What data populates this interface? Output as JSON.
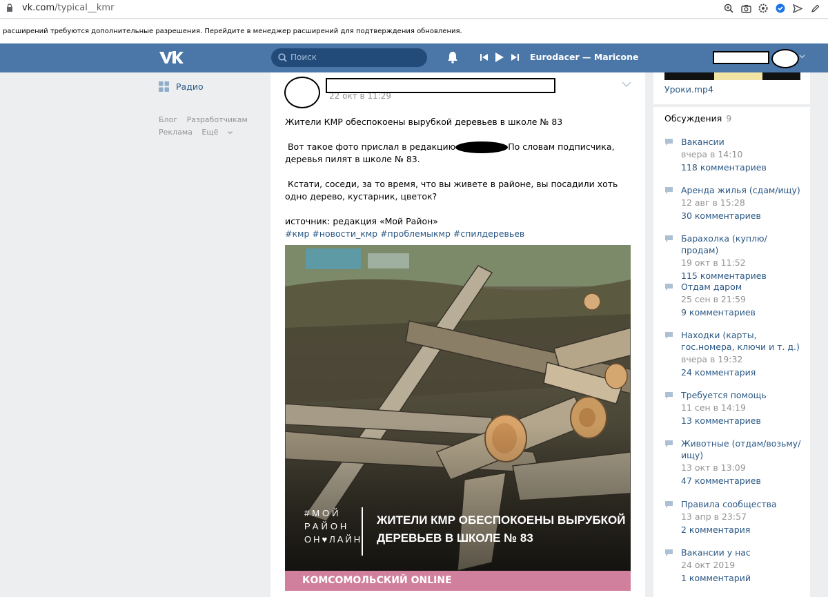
{
  "browser": {
    "url_host": "vk.com",
    "url_path": "/typical__kmr",
    "icons": [
      "zoom-icon",
      "camera-icon",
      "settings-icon",
      "shield-extension-icon",
      "send-icon",
      "pencil-icon"
    ]
  },
  "notice": {
    "text": "расширений требуются дополнительные разрешения. Перейдите в менеджер расширений для подтверждения обновления."
  },
  "header": {
    "search_placeholder": "Поиск",
    "track": "Eurodacer — Maricone",
    "accent": "#4a76a8"
  },
  "leftnav": {
    "items": [
      {
        "label": "Радио",
        "icon": "grid-icon"
      }
    ],
    "footer": [
      "Блог",
      "Разработчикам",
      "Реклама",
      "Ещё"
    ]
  },
  "post": {
    "date": "22 окт в 11:29",
    "title": "Жители КМР обеспокоены вырубкой деревьев в школе № 83",
    "para1_a": "Вот такое фото прислал в редакцию",
    "para1_b": "По словам подписчика, деревья пилят в школе № 83.",
    "para2": "Кстати, соседи, за то время, что вы живете в районе, вы посадили хоть одно дерево, кустарник, цветок?",
    "source": "источник: редакция «Мой Район»",
    "hashtags": "#кмр #новости_кмр #проблемыкмр #спилдеревьев",
    "image": {
      "logo": [
        "#МОЙ",
        "РАЙОН",
        "ОН♥ЛАЙН"
      ],
      "headline_1": "ЖИТЕЛИ КМР ОБЕСПОКОЕНЫ ВЫРУБКОЙ",
      "headline_2": "ДЕРЕВЬЕВ В ШКОЛЕ № 83",
      "band": "КОМСОМОЛЬСКИЙ ONLINE"
    }
  },
  "right": {
    "video_title": "Уроки.mp4",
    "discussions_label": "Обсуждения",
    "discussions_count": "9",
    "topics": [
      {
        "title": "Вакансии",
        "time": "вчера в 14:10",
        "count": "118 комментариев"
      },
      {
        "title": "Аренда жилья (сдам/ищу)",
        "time": "12 авг в 15:28",
        "count": "30 комментариев"
      },
      {
        "title": "Барахолка (куплю/продам)",
        "time": "19 окт в 11:52",
        "count": "115 комментариев"
      },
      {
        "title": "Отдам даром",
        "time": "25 сен в 21:59",
        "count": "9 комментариев"
      },
      {
        "title": "Находки (карты, гос.номера, ключи и т. д.)",
        "time": "вчера в 19:32",
        "count": "24 комментария"
      },
      {
        "title": "Требуется помощь",
        "time": "11 сен в 14:19",
        "count": "13 комментариев"
      },
      {
        "title": "Животные (отдам/возьму/ищу)",
        "time": "13 окт в 13:09",
        "count": "47 комментариев"
      },
      {
        "title": "Правила сообщества",
        "time": "13 апр в 23:57",
        "count": "2 комментария"
      },
      {
        "title": "Вакансии у нас",
        "time": "24 окт 2019",
        "count": "1 комментарий"
      }
    ]
  }
}
